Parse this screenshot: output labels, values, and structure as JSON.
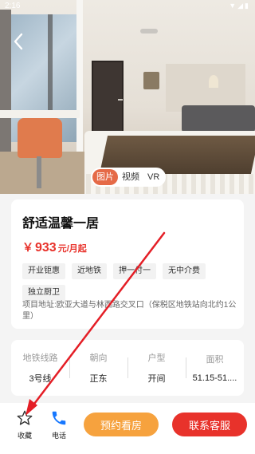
{
  "status_bar": {
    "time": "2:16"
  },
  "media_tabs": [
    {
      "label": "图片",
      "active": true
    },
    {
      "label": "视频",
      "active": false
    },
    {
      "label": "VR",
      "active": false
    }
  ],
  "listing": {
    "title": "舒适温馨一居",
    "price_symbol": "￥",
    "price_amount": "933",
    "price_unit": "元/月起",
    "tags": [
      "开业钜惠",
      "近地铁",
      "押一付一",
      "无中介费",
      "独立厨卫"
    ],
    "address": "项目地址:欧亚大道与林西路交叉口（保税区地铁站向北约1公里）"
  },
  "specs": [
    {
      "label": "地铁线路",
      "value": "3号线"
    },
    {
      "label": "朝向",
      "value": "正东"
    },
    {
      "label": "户型",
      "value": "开间"
    },
    {
      "label": "面积",
      "value": "51.15-51...."
    }
  ],
  "bottom_bar": {
    "favorite_label": "收藏",
    "phone_label": "电话",
    "book_label": "预约看房",
    "contact_label": "联系客服"
  },
  "colors": {
    "accent_red": "#e8322b",
    "accent_orange": "#f6a23e",
    "tab_active": "#e56a47",
    "phone_icon": "#1677ff",
    "annotation_arrow": "#e41e26"
  }
}
